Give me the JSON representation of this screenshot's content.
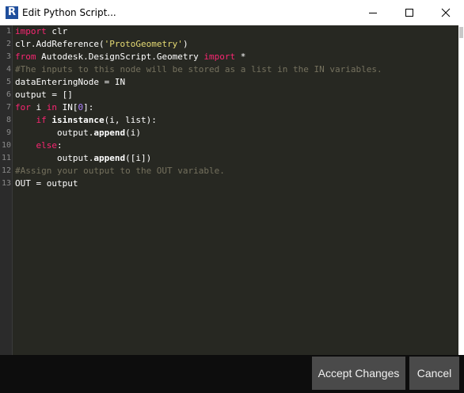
{
  "window": {
    "title": "Edit Python Script...",
    "icon_letter": "R"
  },
  "editor": {
    "line_numbers": [
      "1",
      "2",
      "3",
      "4",
      "5",
      "6",
      "7",
      "8",
      "9",
      "10",
      "11",
      "12",
      "13"
    ],
    "lines": [
      [
        {
          "t": "import",
          "c": "kw"
        },
        {
          "t": " clr"
        }
      ],
      [
        {
          "t": "clr.AddReference("
        },
        {
          "t": "'ProtoGeometry'",
          "c": "str"
        },
        {
          "t": ")"
        }
      ],
      [
        {
          "t": "from",
          "c": "kw"
        },
        {
          "t": " Autodesk.DesignScript.Geometry "
        },
        {
          "t": "import",
          "c": "kw"
        },
        {
          "t": " *"
        }
      ],
      [
        {
          "t": "#The inputs to this node will be stored as a list in the IN variables.",
          "c": "com"
        }
      ],
      [
        {
          "t": "dataEnteringNode = IN"
        }
      ],
      [
        {
          "t": "output = []"
        }
      ],
      [
        {
          "t": "for",
          "c": "kw"
        },
        {
          "t": " i "
        },
        {
          "t": "in",
          "c": "kw"
        },
        {
          "t": " IN["
        },
        {
          "t": "0",
          "c": "num"
        },
        {
          "t": "]:"
        }
      ],
      [
        {
          "t": "    "
        },
        {
          "t": "if",
          "c": "kw"
        },
        {
          "t": " "
        },
        {
          "t": "isinstance",
          "c": "bold"
        },
        {
          "t": "(i, list):"
        }
      ],
      [
        {
          "t": "        output."
        },
        {
          "t": "append",
          "c": "bold"
        },
        {
          "t": "(i)"
        }
      ],
      [
        {
          "t": "    "
        },
        {
          "t": "else",
          "c": "kw"
        },
        {
          "t": ":"
        }
      ],
      [
        {
          "t": "        output."
        },
        {
          "t": "append",
          "c": "bold"
        },
        {
          "t": "([i])"
        }
      ],
      [
        {
          "t": "#Assign your output to the OUT variable.",
          "c": "com"
        }
      ],
      [
        {
          "t": "OUT = output"
        }
      ]
    ]
  },
  "footer": {
    "accept_label": "Accept Changes",
    "cancel_label": "Cancel"
  },
  "colors": {
    "editor_bg": "#272822",
    "keyword": "#f92672",
    "string": "#e6db74",
    "number": "#ae81ff",
    "comment": "#75715e",
    "button_bg": "#4a4a4a",
    "footer_bg": "#0d0d0d"
  },
  "icons": {
    "minimize": "minimize-icon",
    "maximize": "maximize-icon",
    "close": "close-icon"
  }
}
